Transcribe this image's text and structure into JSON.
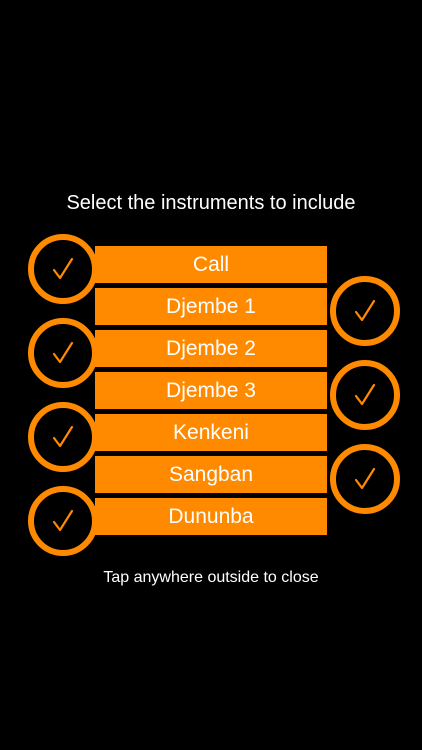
{
  "dialog": {
    "title": "Select the instruments to include",
    "footer": "Tap anywhere outside to close"
  },
  "colors": {
    "accent": "#ff8a00",
    "background": "#000000",
    "text": "#ffffff"
  },
  "instruments": [
    {
      "label": "Call",
      "checked": true,
      "icon": "check-icon"
    },
    {
      "label": "Djembe 1",
      "checked": true,
      "icon": "check-icon"
    },
    {
      "label": "Djembe 2",
      "checked": true,
      "icon": "check-icon"
    },
    {
      "label": "Djembe 3",
      "checked": true,
      "icon": "check-icon"
    },
    {
      "label": "Kenkeni",
      "checked": true,
      "icon": "check-icon"
    },
    {
      "label": "Sangban",
      "checked": true,
      "icon": "check-icon"
    },
    {
      "label": "Dununba",
      "checked": true,
      "icon": "check-icon"
    }
  ]
}
